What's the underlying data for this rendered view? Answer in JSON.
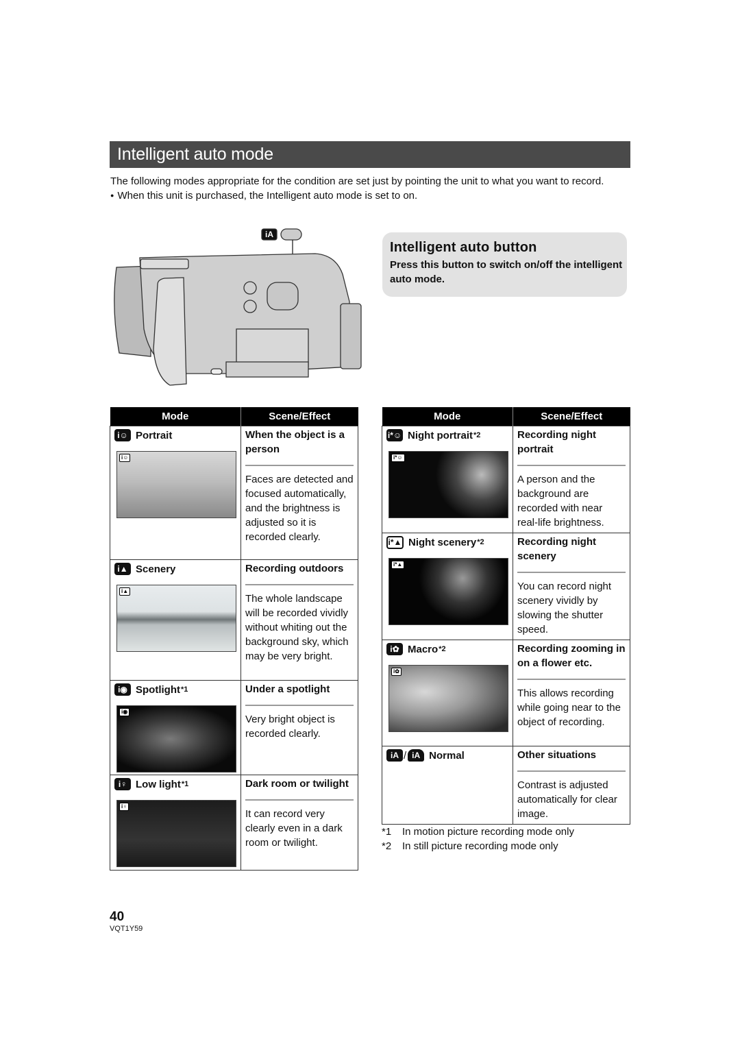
{
  "section": {
    "title": "Intelligent auto mode",
    "intro": "The following modes appropriate for the condition are set just by pointing the unit to what you want to record.",
    "note": "When this unit is purchased, the Intelligent auto mode is set to on."
  },
  "illustration": {
    "button_icon_label": "iA",
    "description": "Camcorder side view with Intelligent auto button indicated"
  },
  "callout": {
    "title": "Intelligent auto button",
    "text": "Press this button to switch on/off the intelligent auto mode."
  },
  "table_headers": {
    "mode": "Mode",
    "scene": "Scene/Effect"
  },
  "left_table": [
    {
      "icon": "portrait-icon",
      "icon_text": "i☺",
      "name": "Portrait",
      "footnote": "",
      "photo_tag": "i☺",
      "photo": "portrait",
      "scene": "When the object is a person",
      "desc": "Faces are detected and focused automatically, and the brightness is adjusted so it is recorded clearly."
    },
    {
      "icon": "scenery-icon",
      "icon_text": "i▲",
      "name": "Scenery",
      "footnote": "",
      "photo_tag": "i▲",
      "photo": "scenery",
      "scene": "Recording outdoors",
      "desc": "The whole landscape will be recorded vividly without whiting out the background sky, which may be very bright."
    },
    {
      "icon": "spotlight-icon",
      "icon_text": "i◉",
      "name": "Spotlight",
      "footnote": "*1",
      "photo_tag": "i◉",
      "photo": "spotlight",
      "scene": "Under a spotlight",
      "desc": "Very bright object is recorded clearly."
    },
    {
      "icon": "low-light-icon",
      "icon_text": "i♀",
      "name": "Low light",
      "footnote": "*1",
      "photo_tag": "i♀",
      "photo": "lowlight",
      "scene": "Dark room or twilight",
      "desc": "It can record very clearly even in a dark room or twilight."
    }
  ],
  "right_table": [
    {
      "icon": "night-portrait-icon",
      "icon_text": "i*☺",
      "name": "Night portrait",
      "footnote": "*2",
      "photo_tag": "i*☺",
      "photo": "nightportrait",
      "scene": "Recording night portrait",
      "desc": "A person and the background are recorded with near real-life brightness."
    },
    {
      "icon": "night-scenery-icon",
      "icon_text": "i*▲",
      "name": "Night scenery",
      "footnote": "*2",
      "photo_tag": "i*▲",
      "photo": "nightscenery",
      "scene": "Recording night scenery",
      "desc": "You can record night scenery vividly by slowing the shutter speed."
    },
    {
      "icon": "macro-icon",
      "icon_text": "i✿",
      "name": "Macro",
      "footnote": "*2",
      "photo_tag": "i✿",
      "photo": "macro",
      "scene": "Recording zooming in on a flower etc.",
      "desc": "This allows recording while going near to the object of recording."
    },
    {
      "icon": "normal-icon",
      "icon_text": "iA",
      "icon_text_2": "iA",
      "separator": "/",
      "name": "Normal",
      "footnote": "",
      "scene": "Other situations",
      "desc": "Contrast is adjusted automatically for clear image."
    }
  ],
  "footnotes": [
    {
      "mark": "*1",
      "text": "In motion picture recording mode only"
    },
    {
      "mark": "*2",
      "text": "In still picture recording mode only"
    }
  ],
  "page": {
    "number": "40",
    "code": "VQT1Y59"
  }
}
